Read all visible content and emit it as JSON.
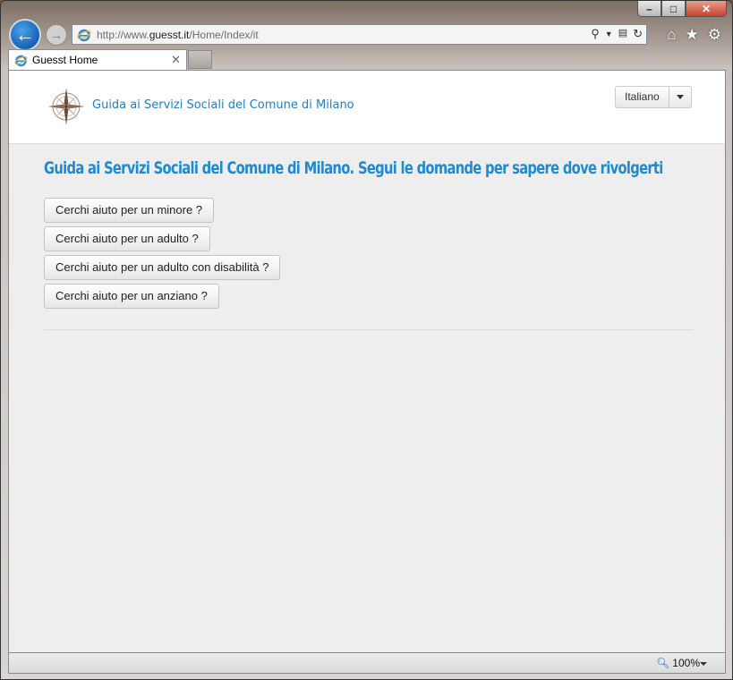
{
  "browser": {
    "url_prefix": "http://www.",
    "url_domain": "guesst.it",
    "url_path": "/Home/Index/it",
    "tab_title": "Guesst Home",
    "zoom": "100%"
  },
  "header": {
    "brand": "Guida ai Servizi Sociali del Comune di Milano",
    "language": "Italiano"
  },
  "main": {
    "title": "Guida ai Servizi Sociali del Comune di Milano. Segui le domande per sapere dove rivolgerti",
    "questions": [
      "Cerchi aiuto per un minore ?",
      "Cerchi aiuto per un adulto ?",
      "Cerchi aiuto per un adulto con disabilità ?",
      "Cerchi aiuto per un anziano ?"
    ]
  },
  "colors": {
    "accent": "#1f8ad0",
    "brand": "#1f7fc4"
  }
}
